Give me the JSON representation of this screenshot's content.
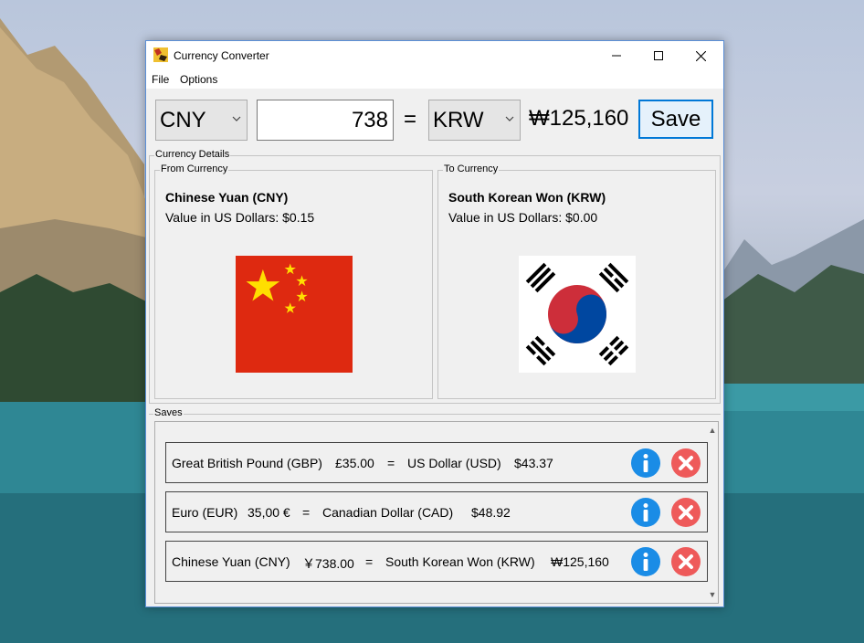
{
  "window": {
    "title": "Currency Converter",
    "menu": [
      "File",
      "Options"
    ]
  },
  "converter": {
    "from_currency": "CNY",
    "amount": "738",
    "equals": "=",
    "to_currency": "KRW",
    "result": "₩125,160",
    "save_label": "Save"
  },
  "details": {
    "group_label": "Currency Details",
    "from": {
      "label": "From Currency",
      "name": "Chinese Yuan (CNY)",
      "value_text": "Value in US Dollars: $0.15",
      "flag_icon": "china-flag-icon"
    },
    "to": {
      "label": "To Currency",
      "name": "South Korean Won (KRW)",
      "value_text": "Value in US Dollars: $0.00",
      "flag_icon": "south-korea-flag-icon"
    }
  },
  "saves": {
    "group_label": "Saves",
    "rows": [
      {
        "from_name": "Great British Pound (GBP)",
        "from_amount": "£35.00",
        "eq": "=",
        "to_name": "US Dollar (USD)",
        "to_amount": "$43.37"
      },
      {
        "from_name": "Euro (EUR)",
        "from_amount": "35,00 €",
        "eq": "=",
        "to_name": "Canadian Dollar (CAD)",
        "to_amount": "$48.92"
      },
      {
        "from_name": "Chinese Yuan (CNY)",
        "from_amount": "￥738.00",
        "eq": "=",
        "to_name": "South Korean Won (KRW)",
        "to_amount": "₩125,160"
      }
    ]
  },
  "colors": {
    "accent": "#0078d7",
    "info_blue": "#1a8ce6",
    "delete_red": "#ee5a5a",
    "china_red": "#de2910",
    "china_gold": "#ffde00",
    "korea_red": "#cd2e3a",
    "korea_blue": "#0047a0"
  }
}
